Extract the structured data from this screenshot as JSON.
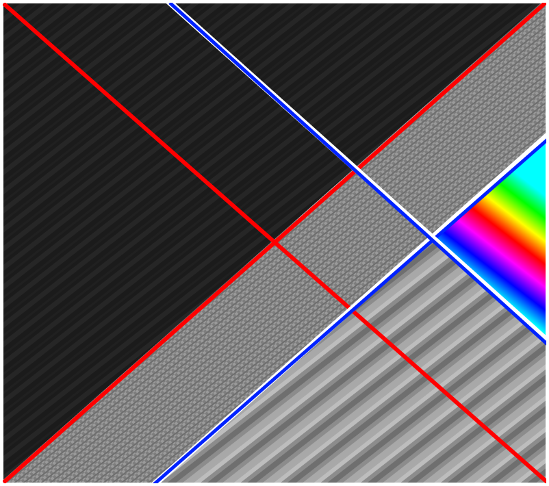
{
  "figure": {
    "colors": {
      "frame": "#ffffff",
      "dark_region": "#1c1c1c",
      "mid_gray": "#8a8a8a",
      "line_red": "#ff0000",
      "line_blue": "#0022ff",
      "line_white": "#ffffff"
    },
    "spectrum": [
      "#ff00ff",
      "#ff0000",
      "#ffff00",
      "#00ff00",
      "#00ffff",
      "#0000ff",
      "#ff00ff",
      "#ff0000",
      "#ffff00",
      "#00ff00",
      "#00ffff"
    ]
  }
}
